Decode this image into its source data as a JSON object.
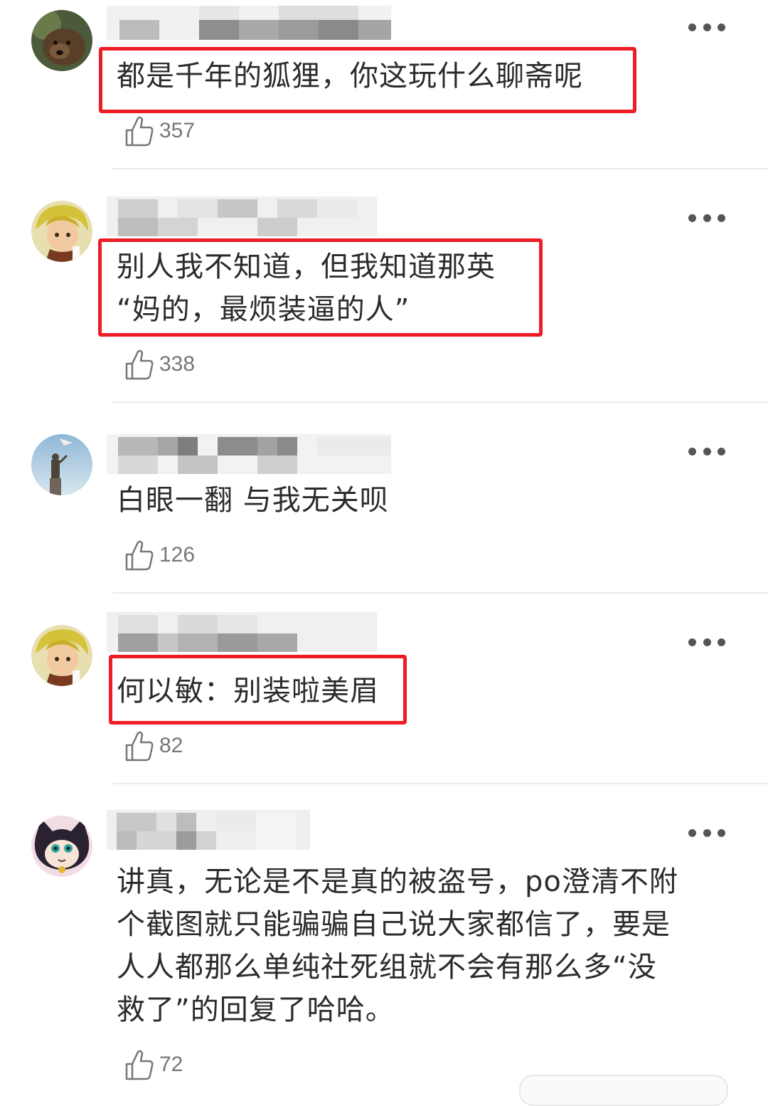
{
  "icons": {
    "more": "more-horizontal-icon",
    "like": "thumbs-up-icon"
  },
  "colors": {
    "highlight": "#ee1c25",
    "text": "#2b2b2b",
    "count": "#777777",
    "divider": "#ececec"
  },
  "comments": [
    {
      "text": "都是千年的狐狸，你这玩什么聊斋呢",
      "likes": "357",
      "highlighted": true
    },
    {
      "text": "别人我不知道，但我知道那英\n“妈的，最烦装逼的人”",
      "likes": "338",
      "highlighted": true
    },
    {
      "text": "白眼一翻 与我无关呗",
      "likes": "126",
      "highlighted": false
    },
    {
      "text": "何以敏：别装啦美眉",
      "likes": "82",
      "highlighted": true
    },
    {
      "text": "讲真，无论是不是真的被盗号，po澄清不附\n个截图就只能骗骗自己说大家都信了，要是\n人人都那么单纯社死组就不会有那么多“没\n救了”的回复了哈哈。",
      "likes": "72",
      "highlighted": false
    }
  ]
}
